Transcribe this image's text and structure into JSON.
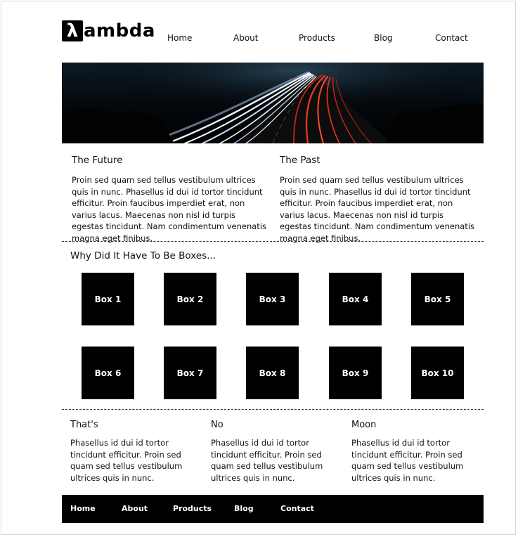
{
  "brand": {
    "logo_glyph": "λ",
    "logo_text": "ambda"
  },
  "nav": {
    "home": "Home",
    "about": "About",
    "products": "Products",
    "blog": "Blog",
    "contact": "Contact"
  },
  "hero": {
    "icon": "highway-light-trails-photo"
  },
  "columns": [
    {
      "title": "The Future",
      "body": "Proin sed quam sed tellus vestibulum ultrices quis in nunc. Phasellus id dui id tortor tincidunt efficitur. Proin faucibus imperdiet erat, non varius lacus. Maecenas non nisl id turpis egestas tincidunt. Nam condimentum venenatis magna eget finibus."
    },
    {
      "title": "The Past",
      "body": "Proin sed quam sed tellus vestibulum ultrices quis in nunc. Phasellus id dui id tortor tincidunt efficitur. Proin faucibus imperdiet erat, non varius lacus. Maecenas non nisl id turpis egestas tincidunt. Nam condimentum venenatis magna eget finibus."
    }
  ],
  "boxes_section": {
    "title": "Why Did It Have To Be Boxes...",
    "boxes": [
      "Box 1",
      "Box 2",
      "Box 3",
      "Box 4",
      "Box 5",
      "Box 6",
      "Box 7",
      "Box 8",
      "Box 9",
      "Box 10"
    ]
  },
  "trio": [
    {
      "title": "That's",
      "body": "Phasellus id dui id tortor tincidunt efficitur. Proin sed quam sed tellus vestibulum ultrices quis in nunc."
    },
    {
      "title": "No",
      "body": "Phasellus id dui id tortor tincidunt efficitur. Proin sed quam sed tellus vestibulum ultrices quis in nunc."
    },
    {
      "title": "Moon",
      "body": "Phasellus id dui id tortor tincidunt efficitur. Proin sed quam sed tellus vestibulum ultrices quis in nunc."
    }
  ],
  "footer": {
    "home": "Home",
    "about": "About",
    "products": "Products",
    "blog": "Blog",
    "contact": "Contact"
  },
  "colors": {
    "brand": "#000000",
    "background": "#ffffff",
    "text": "#111111",
    "trail_white": "#dbe6ff",
    "trail_red": "#d8321e"
  }
}
